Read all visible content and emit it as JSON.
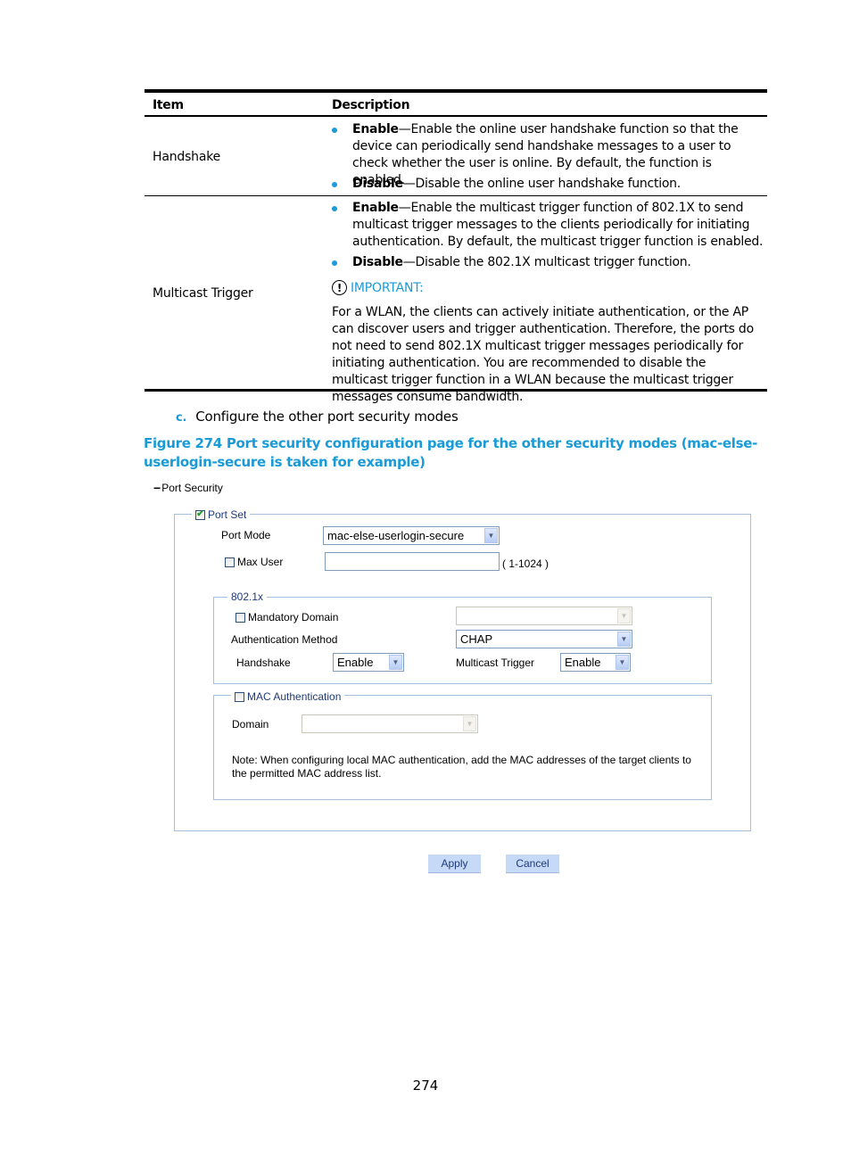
{
  "table": {
    "headers": [
      "Item",
      "Description"
    ],
    "rows": [
      {
        "item": "Handshake",
        "bullets": [
          {
            "term": "Enable",
            "text": "—Enable the online user handshake function so that the device can periodically send handshake messages to a user to check whether the user is online. By default, the function is enabled."
          },
          {
            "term": "Disable",
            "text": "—Disable the online user handshake function."
          }
        ]
      },
      {
        "item": "Multicast Trigger",
        "bullets": [
          {
            "term": "Enable",
            "text": "—Enable the multicast trigger function of 802.1X to send multicast trigger messages to the clients periodically for initiating authentication. By default, the multicast trigger function is enabled."
          },
          {
            "term": "Disable",
            "text": "—Disable the 802.1X multicast trigger function."
          }
        ],
        "important_label": "IMPORTANT:",
        "important_icon": "exclamation-circle-icon",
        "important_text": "For a WLAN, the clients can actively initiate authentication, or the AP can discover users and trigger authentication. Therefore, the ports do not need to send 802.1X multicast trigger messages periodically for initiating authentication. You are recommended to disable the multicast trigger function in a WLAN because the multicast trigger messages consume bandwidth."
      }
    ]
  },
  "step": {
    "label": "c.",
    "text": "Configure the other port security modes"
  },
  "figure_caption": "Figure 274 Port security configuration page for the other security modes (mac-else-userlogin-secure is taken for example)",
  "ui": {
    "section_title": "Port Security",
    "section_toggle": "−",
    "port_set": {
      "legend": "Port Set",
      "checked": true,
      "port_mode_label": "Port Mode",
      "port_mode_value": "mac-else-userlogin-secure",
      "max_user_label": "Max User",
      "max_user_checked": false,
      "max_user_value": "",
      "max_user_range": "( 1-1024 )"
    },
    "dot1x": {
      "legend": "802.1x",
      "mandatory_domain_label": "Mandatory Domain",
      "mandatory_domain_checked": false,
      "mandatory_domain_value": "",
      "auth_method_label": "Authentication Method",
      "auth_method_value": "CHAP",
      "handshake_label": "Handshake",
      "handshake_value": "Enable",
      "multicast_trigger_label": "Multicast Trigger",
      "multicast_trigger_value": "Enable"
    },
    "mac_auth": {
      "legend": "MAC Authentication",
      "checked": false,
      "domain_label": "Domain",
      "domain_value": "",
      "note": "Note: When configuring local MAC authentication, add the MAC addresses of the target clients to the permitted MAC address list."
    },
    "buttons": {
      "apply": "Apply",
      "cancel": "Cancel"
    }
  },
  "page_number": "274",
  "colors": {
    "accent": "#1a9bd7",
    "fieldset_border": "#a5bfdc",
    "button_bg": "#c6d9f6"
  }
}
